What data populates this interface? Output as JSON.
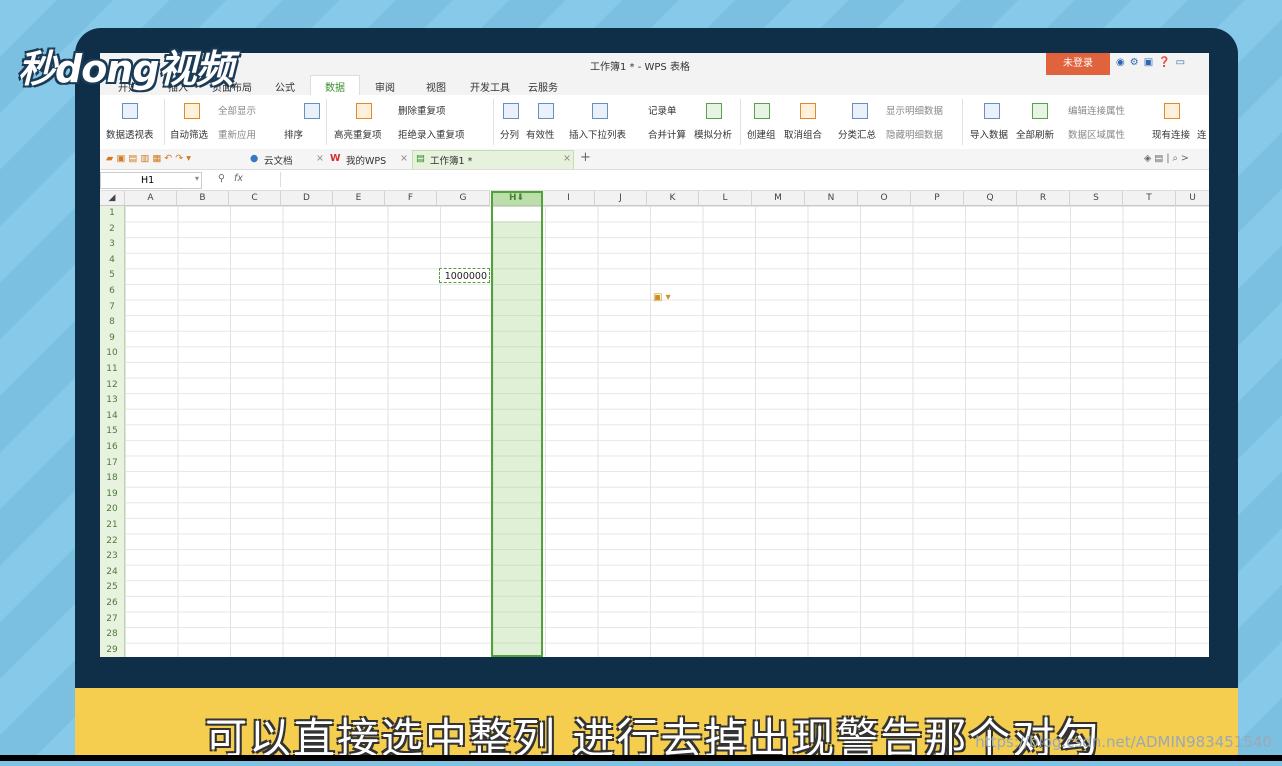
{
  "brand": {
    "logo_text": "秒dong视频"
  },
  "subtitle": "可以直接选中整列 进行去掉出现警告那个对勾",
  "watermark": "https://blog.csdn.net/ADMIN983451540",
  "window": {
    "title": "工作簿1 * - WPS 表格",
    "login_button": "未登录"
  },
  "menu": [
    "开始",
    "插入",
    "页面布局",
    "公式",
    "数据",
    "审阅",
    "视图",
    "开发工具",
    "云服务"
  ],
  "menu_active": "数据",
  "ribbon": {
    "pivot": "数据透视表",
    "autofilter": "自动筛选",
    "show_all": "全部显示",
    "reapply": "重新应用",
    "sort": "排序",
    "highlight_dup": "高亮重复项",
    "delete_dup": "删除重复项",
    "reject_dup": "拒绝录入重复项",
    "split": "分列",
    "validity": "有效性",
    "insert_dropdown": "插入下拉列表",
    "record_form": "记录单",
    "consolidate": "合并计算",
    "whatif": "模拟分析",
    "create_group": "创建组",
    "ungroup": "取消组合",
    "subtotal": "分类汇总",
    "show_detail": "显示明细数据",
    "hide_detail": "隐藏明细数据",
    "import": "导入数据",
    "refresh_all": "全部刷新",
    "edit_link": "编辑连接属性",
    "range_prop": "数据区域属性",
    "existing_conn": "现有连接",
    "conn": "连"
  },
  "tabs": {
    "cloud_docs": "云文档",
    "my_wps": "我的WPS",
    "workbook": "工作簿1 *",
    "new_tab": "+"
  },
  "formula_bar": {
    "name_box": "H1",
    "fx": "fx",
    "value": ""
  },
  "columns": [
    "A",
    "B",
    "C",
    "D",
    "E",
    "F",
    "G",
    "H",
    "I",
    "J",
    "K",
    "L",
    "M",
    "N",
    "O",
    "P",
    "Q",
    "R",
    "S",
    "T",
    "U"
  ],
  "rows": [
    "1",
    "2",
    "3",
    "4",
    "5",
    "6",
    "7",
    "8",
    "9",
    "10",
    "11",
    "12",
    "13",
    "14",
    "15",
    "16",
    "17",
    "18",
    "19",
    "20",
    "21",
    "22",
    "23",
    "24",
    "25",
    "26",
    "27",
    "28",
    "29"
  ],
  "selected_column": "H",
  "cell_G5": "1000000"
}
